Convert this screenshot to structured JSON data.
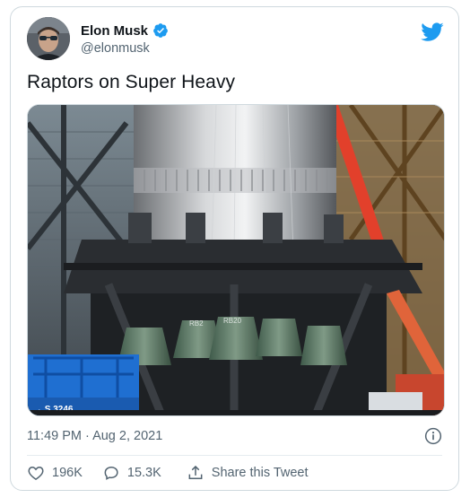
{
  "author": {
    "display_name": "Elon Musk",
    "handle": "@elonmusk",
    "verified": true
  },
  "tweet": {
    "text": "Raptors on Super Heavy",
    "timestamp": "11:49 PM · Aug 2, 2021"
  },
  "media": {
    "engine_labels": [
      "RB2",
      "RB20"
    ],
    "lift_label": "→ S 3246"
  },
  "actions": {
    "like_count": "196K",
    "reply_count": "15.3K",
    "share_label": "Share this Tweet"
  },
  "icons": {
    "verified": "verified-badge-icon",
    "brand": "twitter-bird-icon",
    "info": "info-icon",
    "like": "heart-icon",
    "reply": "reply-bubble-icon",
    "share": "share-icon"
  },
  "colors": {
    "brand_blue": "#1d9bf0",
    "secondary_text": "#536471",
    "border": "#cfd9de"
  }
}
